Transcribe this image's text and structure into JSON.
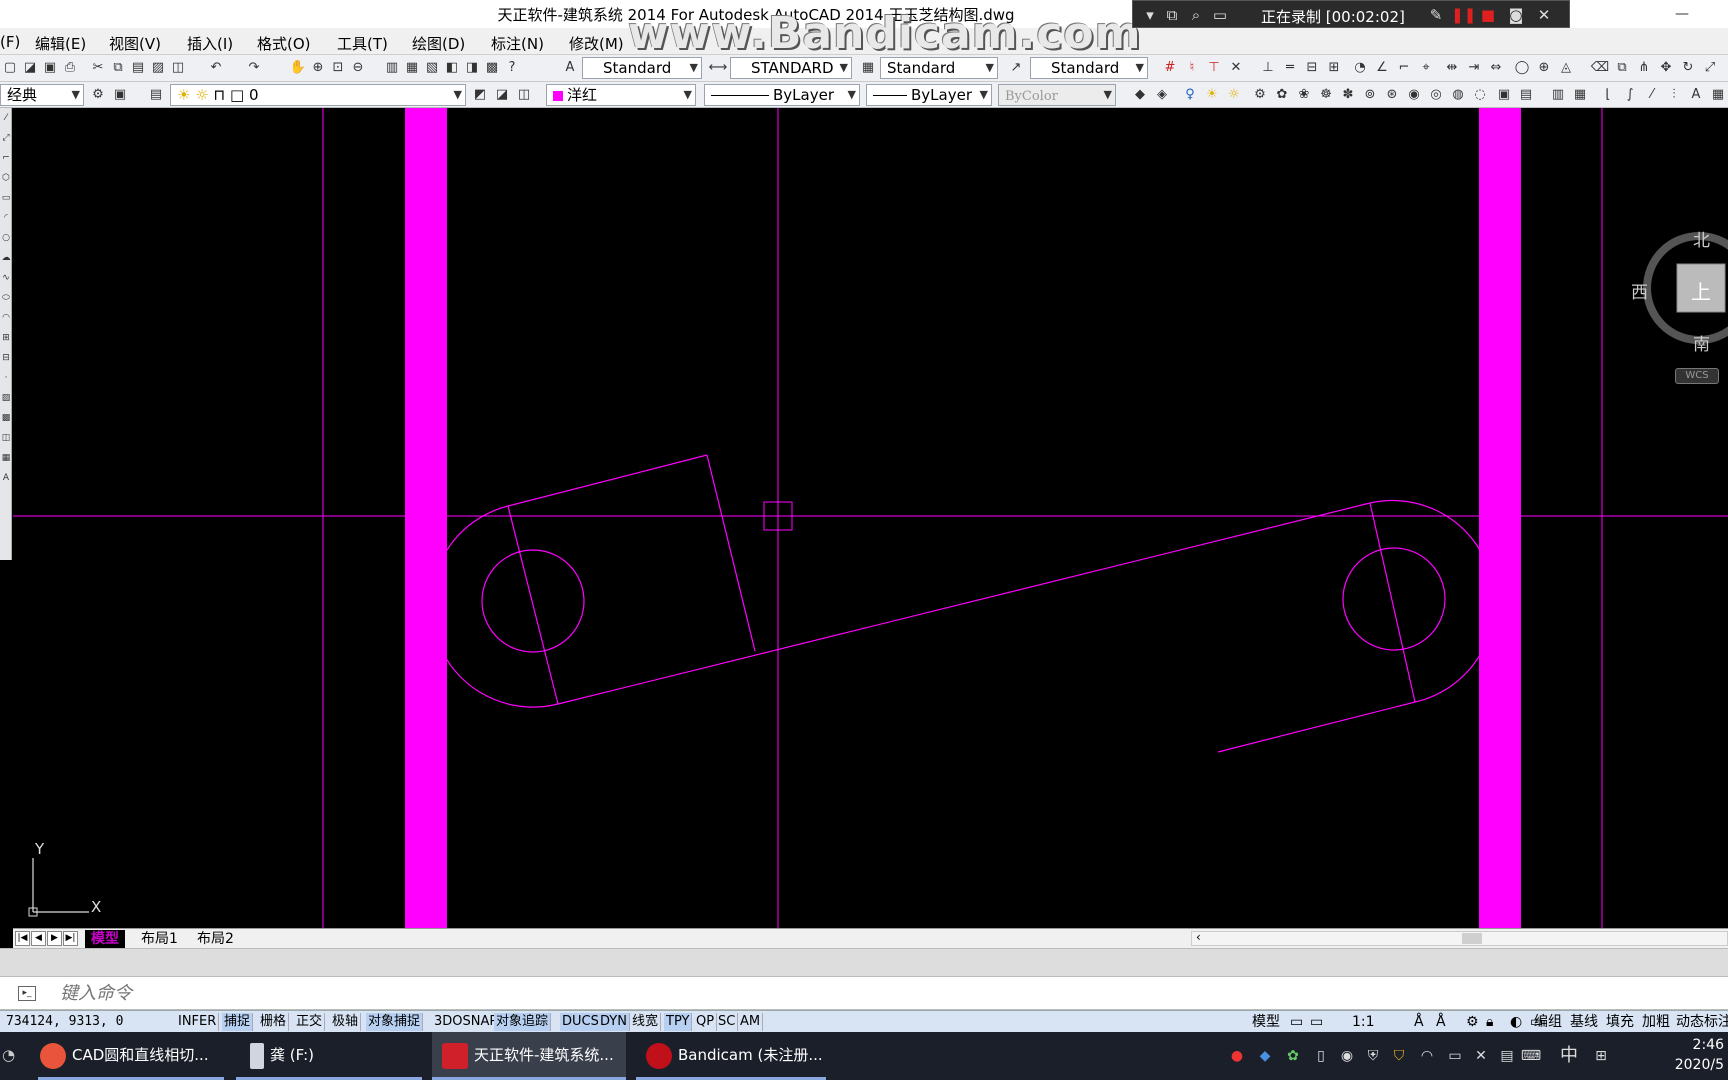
{
  "window": {
    "title": "天正软件-建筑系统 2014  For Autodesk AutoCAD 2014  王玉芝结构图.dwg",
    "watermark": "www.Bandicam.com"
  },
  "recorder": {
    "status": "正在录制 [00:02:02]"
  },
  "menu": {
    "items": [
      "(F)",
      "编辑(E)",
      "视图(V)",
      "插入(I)",
      "格式(O)",
      "工具(T)",
      "绘图(D)",
      "标注(N)",
      "修改(M)"
    ]
  },
  "styles": {
    "text_style": "Standard",
    "dim_style": "STANDARD",
    "table_style": "Standard",
    "multileader_style": "Standard"
  },
  "workspace": {
    "name": "经典"
  },
  "layer": {
    "current": "0"
  },
  "properties": {
    "color": "洋红",
    "color_hex": "#ff00ff",
    "linetype": "ByLayer",
    "lineweight": "ByLayer",
    "plotstyle": "ByColor"
  },
  "viewcube": {
    "north": "北",
    "west": "西",
    "south": "南",
    "face": "上",
    "ucs_label": "WCS"
  },
  "ucs_icon": {
    "x": "X",
    "y": "Y"
  },
  "layout_tabs": [
    "模型",
    "布局1",
    "布局2"
  ],
  "command": {
    "placeholder": "键入命令"
  },
  "status": {
    "coordinates": "734124, 9313, 0",
    "toggles": [
      "INFER",
      "捕捉",
      "栅格",
      "正交",
      "极轴",
      "对象捕捉",
      "3DOSNAP",
      "对象追踪",
      "DUCS",
      "DYN",
      "线宽",
      "TPY",
      "QP",
      "SC",
      "AM"
    ],
    "right_items": [
      "模型",
      "1:1",
      "编组",
      "基线",
      "填充",
      "加粗",
      "动态标注"
    ]
  },
  "taskbar": {
    "tasks": [
      {
        "label": "CAD圆和直线相切...",
        "color": "#e8543c"
      },
      {
        "label": "龚 (F:)",
        "color": "#cfd6e0"
      },
      {
        "label": "天正软件-建筑系统...",
        "color": "#d0202a"
      },
      {
        "label": "Bandicam (未注册...",
        "color": "#c0101a"
      }
    ],
    "ime": "中",
    "time": "2:46",
    "date": "2020/5"
  }
}
